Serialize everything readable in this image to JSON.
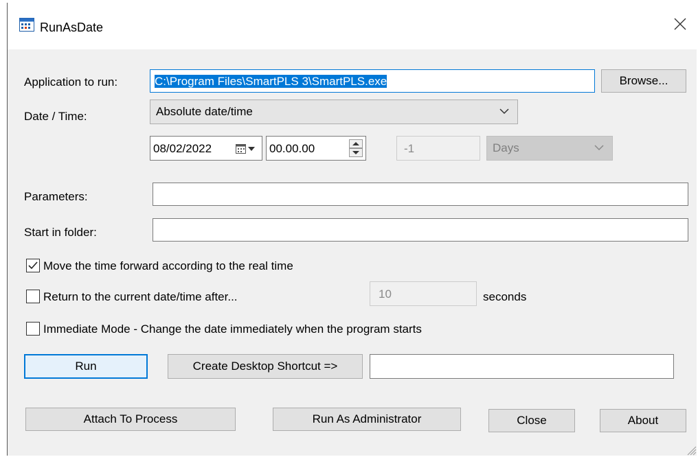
{
  "window": {
    "title": "RunAsDate",
    "icon": "calendar-icon",
    "close_icon": "close-icon"
  },
  "app_to_run": {
    "label": "Application to run:",
    "value": "C:\\Program Files\\SmartPLS 3\\SmartPLS.exe",
    "browse_label": "Browse..."
  },
  "datetime": {
    "label": "Date / Time:",
    "mode": "Absolute date/time",
    "date": "08/02/2022",
    "time": "00.00.00",
    "relative_value": "-1",
    "relative_unit": "Days"
  },
  "parameters": {
    "label": "Parameters:",
    "value": ""
  },
  "start_in": {
    "label": "Start in folder:",
    "value": ""
  },
  "options": {
    "move_forward": {
      "label": "Move the time forward according to the real time",
      "checked": true
    },
    "return_after": {
      "label": "Return to the current date/time after...",
      "checked": false,
      "seconds_value": "10",
      "seconds_label": "seconds"
    },
    "immediate": {
      "label": "Immediate Mode - Change the date immediately when the program starts",
      "checked": false
    }
  },
  "actions": {
    "run": "Run",
    "create_shortcut": "Create Desktop Shortcut =>",
    "shortcut_name": "",
    "attach": "Attach To Process",
    "run_admin": "Run As Administrator",
    "close": "Close",
    "about": "About"
  },
  "colors": {
    "selection": "#0078d7",
    "dialog_bg": "#f0f0f0",
    "button_bg": "#e1e1e1"
  }
}
